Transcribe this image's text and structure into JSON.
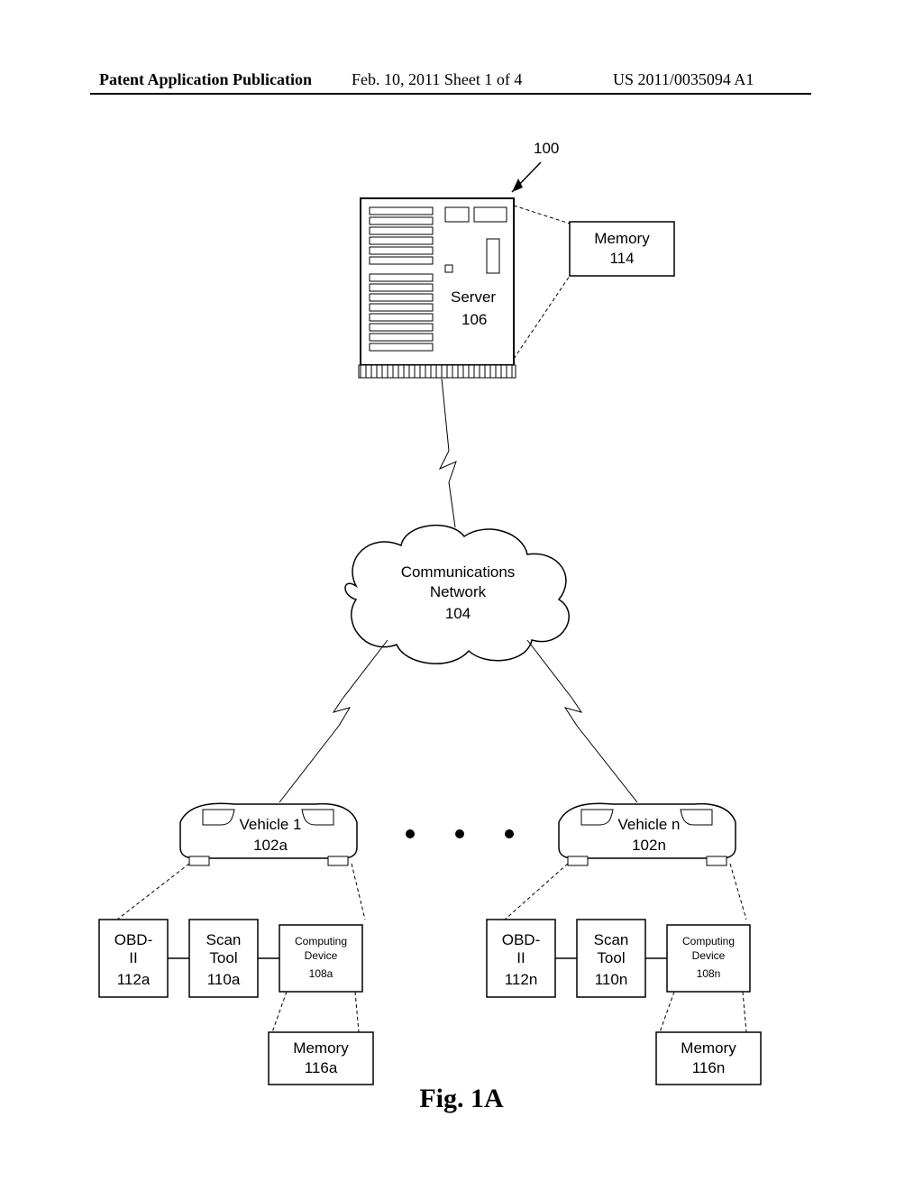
{
  "header": {
    "left": "Patent Application Publication",
    "mid": "Feb. 10, 2011  Sheet 1 of 4",
    "right": "US 2011/0035094 A1"
  },
  "nodes": {
    "system_ref": "100",
    "server": {
      "label": "Server",
      "ref": "106"
    },
    "server_memory": {
      "label": "Memory",
      "ref": "114"
    },
    "network": {
      "label_l1": "Communications",
      "label_l2": "Network",
      "ref": "104"
    },
    "vehicle_a": {
      "label": "Vehicle 1",
      "ref": "102a"
    },
    "vehicle_n": {
      "label": "Vehicle n",
      "ref": "102n"
    },
    "obd_a": {
      "l1": "OBD-",
      "l2": "II",
      "ref": "112a"
    },
    "scan_a": {
      "l1": "Scan",
      "l2": "Tool",
      "ref": "110a"
    },
    "comp_a": {
      "l1": "Computing",
      "l2": "Device",
      "ref": "108a"
    },
    "mem_a": {
      "label": "Memory",
      "ref": "116a"
    },
    "obd_n": {
      "l1": "OBD-",
      "l2": "II",
      "ref": "112n"
    },
    "scan_n": {
      "l1": "Scan",
      "l2": "Tool",
      "ref": "110n"
    },
    "comp_n": {
      "l1": "Computing",
      "l2": "Device",
      "ref": "108n"
    },
    "mem_n": {
      "label": "Memory",
      "ref": "116n"
    }
  },
  "caption": "Fig. 1A"
}
